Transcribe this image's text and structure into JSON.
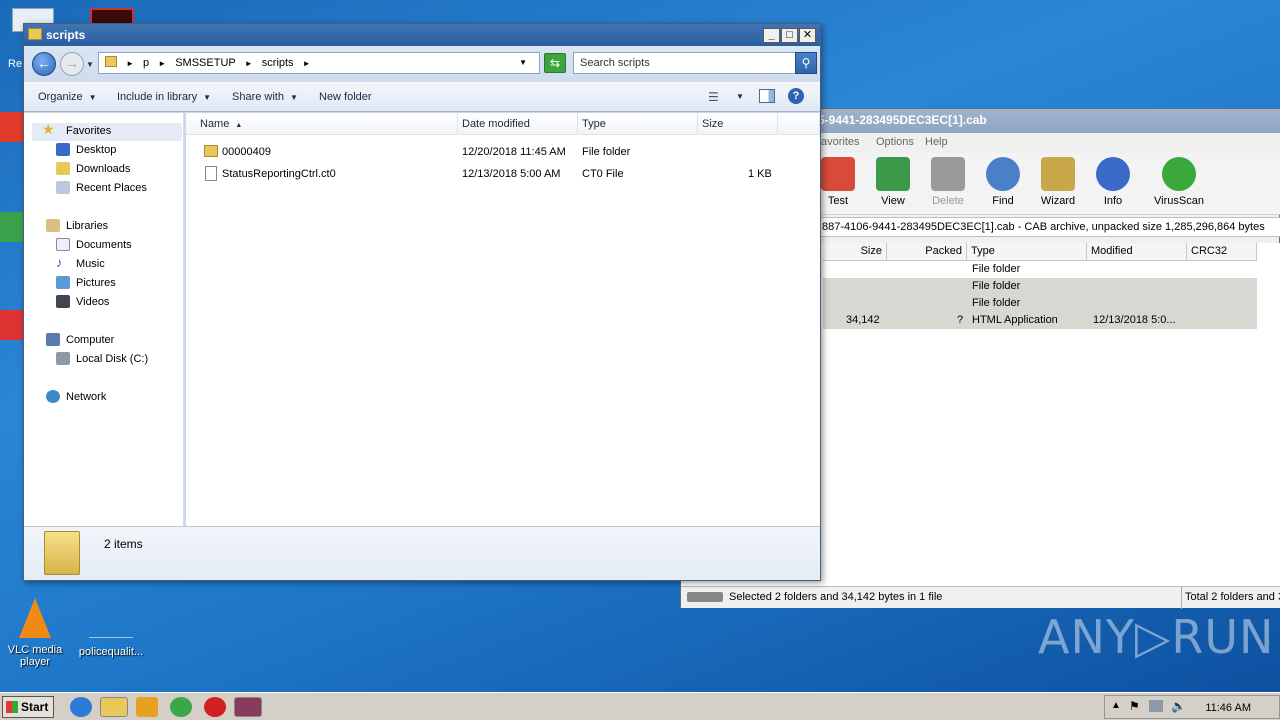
{
  "desktop": {
    "icons": [
      {
        "label": "VLC media player"
      },
      {
        "label": "policequalit..."
      }
    ],
    "partial_labels": [
      "Re"
    ],
    "watermark": "ANY▷RUN"
  },
  "winrar": {
    "title": "5-9441-283495DEC3EC[1].cab",
    "menu": [
      "avorites",
      "Options",
      "Help"
    ],
    "toolbar": [
      "Test",
      "View",
      "Delete",
      "Find",
      "Wizard",
      "Info",
      "VirusScan"
    ],
    "path_text": "887-4106-9441-283495DEC3EC[1].cab - CAB archive, unpacked size 1,285,296,864 bytes",
    "columns": [
      "Size",
      "Packed",
      "Type",
      "Modified",
      "CRC32"
    ],
    "rows": [
      {
        "size": "",
        "packed": "",
        "type": "File folder",
        "modified": ""
      },
      {
        "size": "",
        "packed": "",
        "type": "File folder",
        "modified": ""
      },
      {
        "size": "",
        "packed": "",
        "type": "File folder",
        "modified": ""
      },
      {
        "size": "34,142",
        "packed": "?",
        "type": "HTML Application",
        "modified": "12/13/2018 5:0..."
      }
    ],
    "status_left": "Selected 2 folders and 34,142 bytes in 1 file",
    "status_right": "Total 2 folders and 3"
  },
  "explorer": {
    "title": "scripts",
    "breadcrumb": [
      "p",
      "SMSSETUP",
      "scripts"
    ],
    "search_placeholder": "Search scripts",
    "commands": {
      "organize": "Organize",
      "include": "Include in library",
      "share": "Share with",
      "new_folder": "New folder"
    },
    "nav": {
      "favorites": "Favorites",
      "desktop": "Desktop",
      "downloads": "Downloads",
      "recent": "Recent Places",
      "libraries": "Libraries",
      "documents": "Documents",
      "music": "Music",
      "pictures": "Pictures",
      "videos": "Videos",
      "computer": "Computer",
      "local_disk": "Local Disk (C:)",
      "network": "Network"
    },
    "columns": {
      "name": "Name",
      "date": "Date modified",
      "type": "Type",
      "size": "Size"
    },
    "files": [
      {
        "name": "00000409",
        "date": "12/20/2018 11:45 AM",
        "type": "File folder",
        "size": ""
      },
      {
        "name": "StatusReportingCtrl.ct0",
        "date": "12/13/2018 5:00 AM",
        "type": "CT0 File",
        "size": "1 KB"
      }
    ],
    "item_count": "2 items"
  },
  "taskbar": {
    "start_label": "Start",
    "clock": "11:46 AM"
  }
}
